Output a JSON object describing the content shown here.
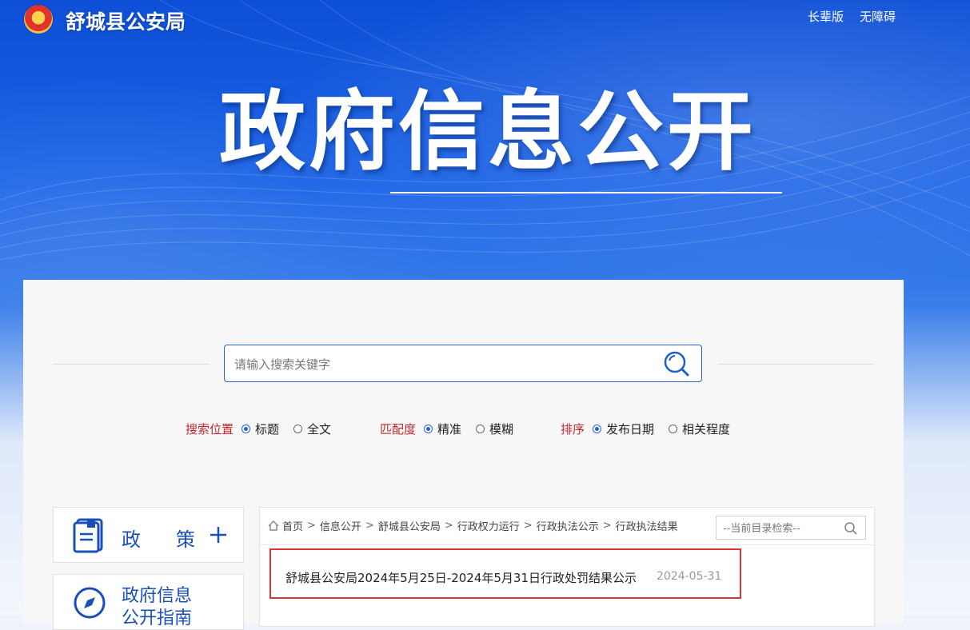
{
  "header": {
    "site_title": "舒城县公安局",
    "top_links": [
      "长辈版",
      "无障碍"
    ]
  },
  "hero": {
    "title": "政府信息公开"
  },
  "search": {
    "placeholder": "请输入搜索关键字",
    "options": {
      "position": {
        "label": "搜索位置",
        "choices": [
          "标题",
          "全文"
        ],
        "selected": "标题"
      },
      "match": {
        "label": "匹配度",
        "choices": [
          "精准",
          "模糊"
        ],
        "selected": "精准"
      },
      "sort": {
        "label": "排序",
        "choices": [
          "发布日期",
          "相关程度"
        ],
        "selected": "发布日期"
      }
    }
  },
  "sidebar": {
    "policy_char_1": "政",
    "policy_char_2": "策",
    "guide_line_1": "政府信息",
    "guide_line_2": "公开指南"
  },
  "breadcrumb": [
    "首页",
    "信息公开",
    "舒城县公安局",
    "行政权力运行",
    "行政执法公示",
    "行政执法结果"
  ],
  "dir_search": {
    "placeholder": "--当前目录检索--"
  },
  "results": [
    {
      "title": "舒城县公安局2024年5月25日-2024年5月31日行政处罚结果公示",
      "date": "2024-05-31"
    }
  ],
  "colors": {
    "accent": "#2463d6",
    "label_red": "#c3252d",
    "highlight_border": "#e03131"
  }
}
